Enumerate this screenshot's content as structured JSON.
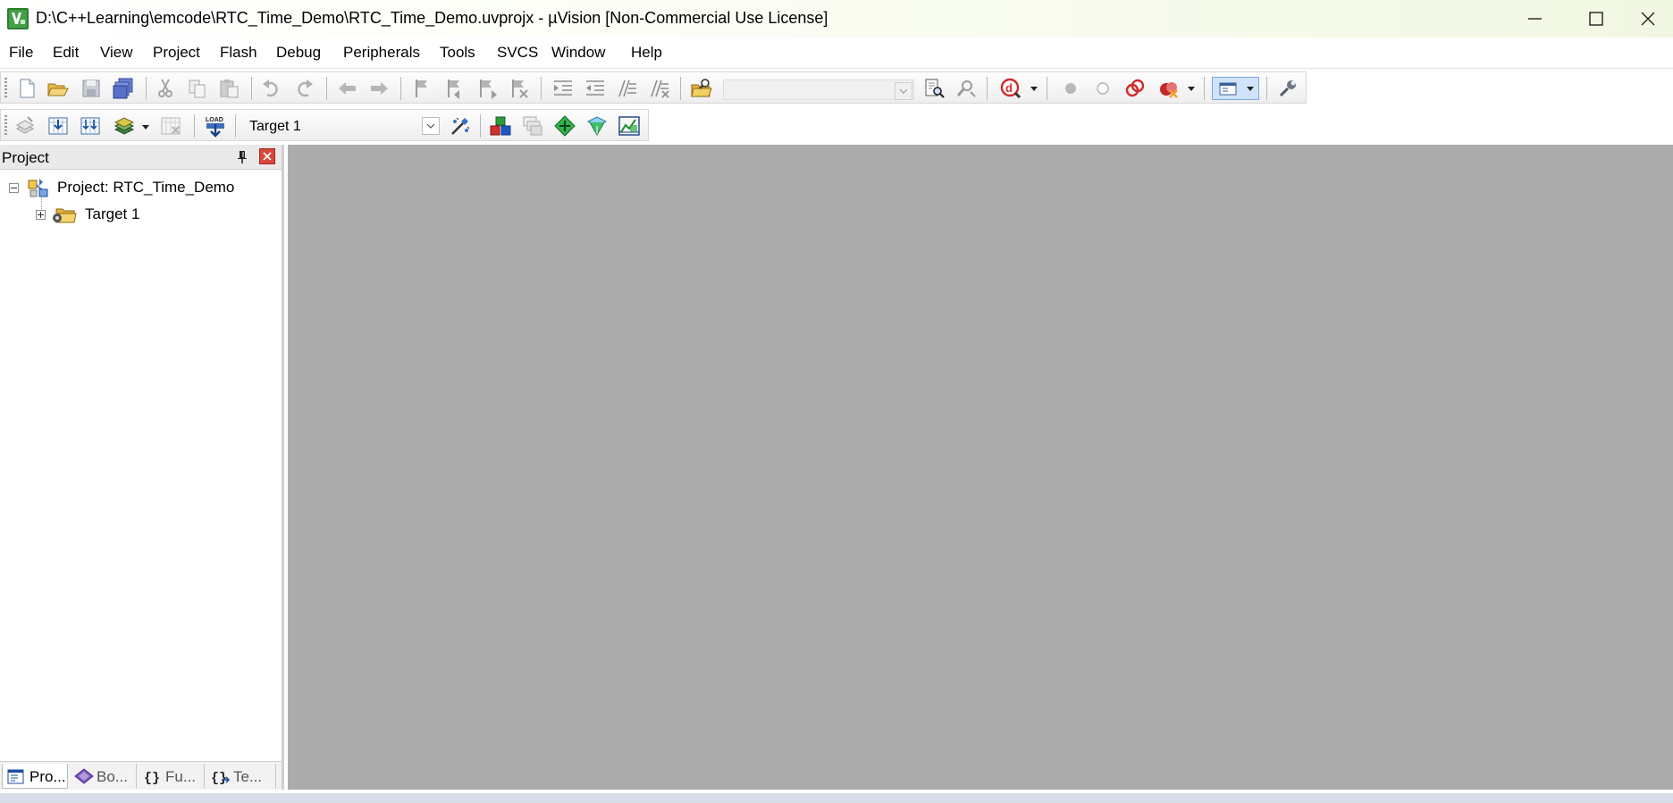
{
  "window": {
    "title": "D:\\C++Learning\\emcode\\RTC_Time_Demo\\RTC_Time_Demo.uvprojx - µVision  [Non-Commercial Use License]",
    "controls": [
      "minimize-icon",
      "maximize-icon",
      "close-icon"
    ]
  },
  "menu": {
    "file": "File",
    "edit": "Edit",
    "view": "View",
    "project": "Project",
    "flash": "Flash",
    "debug": "Debug",
    "peripherals": "Peripherals",
    "tools": "Tools",
    "svcs": "SVCS",
    "window": "Window",
    "help": "Help"
  },
  "toolbar_file": {
    "icons": [
      "new-file-icon",
      "open-file-icon",
      "save-icon",
      "save-all-icon",
      "cut-icon",
      "copy-icon",
      "paste-icon",
      "undo-icon",
      "redo-icon",
      "navigate-back-icon",
      "navigate-forward-icon",
      "bookmark-icon",
      "prev-bookmark-icon",
      "next-bookmark-icon",
      "clear-bookmarks-icon",
      "indent-icon",
      "unindent-icon",
      "comment-icon",
      "uncomment-icon",
      "find-in-files-icon",
      "find-icon",
      "incremental-find-icon",
      "debug-session-icon",
      "breakpoint-icon",
      "disable-breakpoint-icon",
      "kill-breakpoints-icon",
      "kill-all-icon",
      "window-layout-icon",
      "configure-icon"
    ],
    "find_value": ""
  },
  "toolbar_build": {
    "icons": [
      "translate-icon",
      "build-icon",
      "rebuild-icon",
      "batch-build-icon",
      "stop-build-icon",
      "download-load-icon",
      "target-options-icon",
      "manage-components-icon",
      "manage-project-items-icon",
      "select-pack-icon",
      "pack-installer-icon",
      "event-recorder-icon"
    ],
    "load_label": "LOAD",
    "target_value": "Target 1"
  },
  "project_panel": {
    "title": "Project",
    "tree": {
      "root_label": "Project: RTC_Time_Demo",
      "target_label": "Target 1"
    },
    "tabs": {
      "project": "Pro...",
      "books": "Bo...",
      "functions": "Fu...",
      "templates": "Te..."
    }
  },
  "colors": {
    "editor_background": "#ababab",
    "panel_close": "#d9463a",
    "title_gradient_end": "#f1f7e2"
  }
}
